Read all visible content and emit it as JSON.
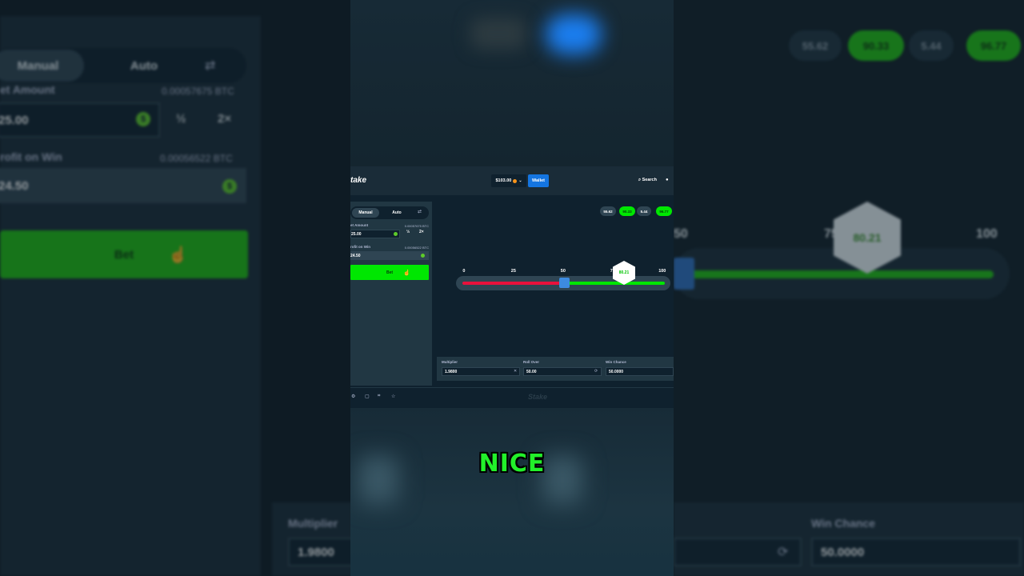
{
  "background": {
    "left": {
      "tabs": {
        "manual": "Manual",
        "auto": "Auto",
        "swap_icon": "swap-icon"
      },
      "bet_amount_label": "et Amount",
      "bet_amount_btc": "0.00057675 BTC",
      "bet_amount_value": "25.00",
      "half": "½",
      "double": "2×",
      "profit_label": "rofit on Win",
      "profit_btc": "0.00056522 BTC",
      "profit_value": "24.50",
      "bet_button": "Bet"
    },
    "right": {
      "pills": [
        "55.62",
        "90.33",
        "5.44",
        "96.77"
      ],
      "ticks": [
        "50",
        "75",
        "100"
      ],
      "hex_value": "80.21",
      "win_chance_label": "Win Chance",
      "win_chance_value": "50.0000"
    },
    "bottom_left": {
      "multiplier_label": "Multiplier",
      "multiplier_value": "1.9800"
    }
  },
  "app": {
    "logo": "take",
    "balance": "$103.00",
    "wallet": "Wallet",
    "search": "Search",
    "tabs": {
      "manual": "Manual",
      "auto": "Auto"
    },
    "bet_amount_label": "et Amount",
    "bet_amount_btc": "0.00057675 BTC",
    "bet_amount_value": "25.00",
    "half": "½",
    "double": "2×",
    "profit_label": "rofit on Win",
    "profit_btc": "0.00056522 BTC",
    "profit_value": "24.50",
    "bet_button": "Bet",
    "recent_results": [
      {
        "value": "55.62",
        "win": false
      },
      {
        "value": "90.33",
        "win": true
      },
      {
        "value": "5.44",
        "win": false
      },
      {
        "value": "96.77",
        "win": true
      }
    ],
    "slider_ticks": [
      "0",
      "25",
      "50",
      "75",
      "100"
    ],
    "roll_result": "80.21",
    "roll_over_target": 50,
    "multiplier_label": "Multiplier",
    "multiplier_value": "1.9800",
    "roll_over_label": "Roll Over",
    "roll_over_value": "50.00",
    "win_chance_label": "Win Chance",
    "win_chance_value": "50.0000",
    "footer_brand": "Stake"
  },
  "caption": "NICE",
  "colors": {
    "accent_green": "#00e701",
    "loss_red": "#e9113c",
    "wallet_blue": "#1475e1",
    "panel": "#213743",
    "bg": "#0f212e"
  }
}
